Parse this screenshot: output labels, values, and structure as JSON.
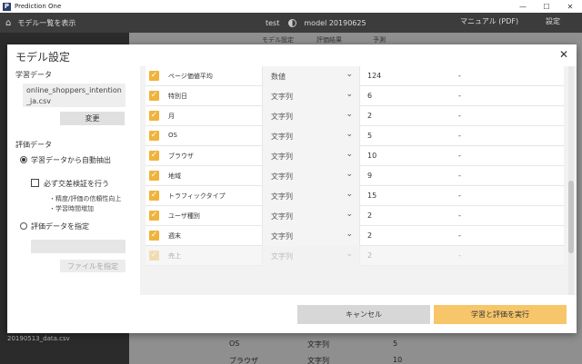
{
  "window": {
    "app_title": "Prediction One",
    "logo_letter": "P",
    "minimize": "—",
    "maximize": "☐",
    "close": "✕"
  },
  "appbar": {
    "home_icon": "⌂",
    "model_list_btn": "モデル一覧を表示",
    "project": "test",
    "model_name": "model 20190625",
    "manual": "マニュアル (PDF)",
    "settings": "設定"
  },
  "background": {
    "tabs": [
      "モデル設定",
      "評価結果",
      "予測"
    ],
    "sidebar_file": "20190513_data.csv",
    "rows": [
      {
        "name": "OS",
        "type": "文字列",
        "count": "5"
      },
      {
        "name": "ブラウザ",
        "type": "文字列",
        "count": "10"
      }
    ]
  },
  "dialog": {
    "title": "モデル設定",
    "close_icon": "✕",
    "training_data_label": "学習データ",
    "training_file": "online_shoppers_intention_ja.csv",
    "change_btn": "変更",
    "eval_data_label": "評価データ",
    "radio_auto": "学習データから自動抽出",
    "cross_validation": "必ず交差検証を行う",
    "note1": "・精度/評価の信頼性向上",
    "note2": "・学習時間増加",
    "radio_specify": "評価データを指定",
    "file_btn": "ファイルを指定",
    "check_mark": "✓",
    "chevron": "⌄",
    "rows": [
      {
        "name": "ページ価値平均",
        "type": "数値",
        "count": "124",
        "dash": "-",
        "disabled": false
      },
      {
        "name": "特別日",
        "type": "文字列",
        "count": "6",
        "dash": "-",
        "disabled": false
      },
      {
        "name": "月",
        "type": "文字列",
        "count": "2",
        "dash": "-",
        "disabled": false
      },
      {
        "name": "OS",
        "type": "文字列",
        "count": "5",
        "dash": "-",
        "disabled": false
      },
      {
        "name": "ブラウザ",
        "type": "文字列",
        "count": "10",
        "dash": "-",
        "disabled": false
      },
      {
        "name": "地域",
        "type": "文字列",
        "count": "9",
        "dash": "-",
        "disabled": false
      },
      {
        "name": "トラフィックタイプ",
        "type": "文字列",
        "count": "15",
        "dash": "-",
        "disabled": false
      },
      {
        "name": "ユーザ種別",
        "type": "文字列",
        "count": "2",
        "dash": "-",
        "disabled": false
      },
      {
        "name": "週末",
        "type": "文字列",
        "count": "2",
        "dash": "-",
        "disabled": false
      },
      {
        "name": "売上",
        "type": "文字列",
        "count": "2",
        "dash": "-",
        "disabled": true
      }
    ],
    "cancel_btn": "キャンセル",
    "run_btn": "学習と評価を実行"
  },
  "colors": {
    "accent": "#f0b43c",
    "run_button": "#f7c66a"
  }
}
